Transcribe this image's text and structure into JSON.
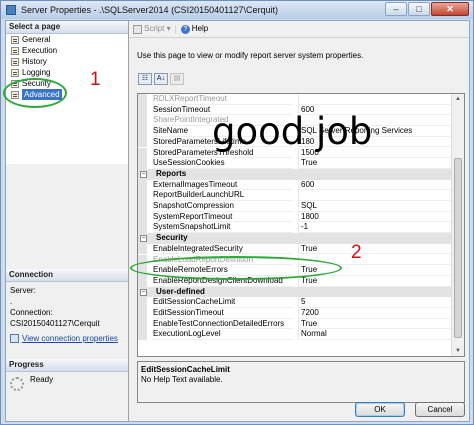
{
  "window": {
    "title": "Server Properties - .\\SQLServer2014 (CSI20150401127\\Cerquit)",
    "controls": {
      "minimize": "–",
      "maximize": "□",
      "close": "✕"
    }
  },
  "sidebar": {
    "select_page_header": "Select a page",
    "pages": [
      {
        "label": "General"
      },
      {
        "label": "Execution"
      },
      {
        "label": "History"
      },
      {
        "label": "Logging"
      },
      {
        "label": "Security"
      },
      {
        "label": "Advanced",
        "selected": true
      }
    ],
    "connection": {
      "header": "Connection",
      "server_label": "Server:",
      "server_value": ".",
      "connection_label": "Connection:",
      "connection_value": "CSI20150401127\\Cerquit",
      "view_link": "View connection properties"
    },
    "progress": {
      "header": "Progress",
      "status": "Ready"
    }
  },
  "toolbar": {
    "script_label": "Script",
    "help_label": "Help"
  },
  "main": {
    "description": "Use this page to view or modify report server system properties."
  },
  "grid": {
    "rows": [
      {
        "type": "prop",
        "name": "RDLXReportTimeout",
        "value": "",
        "disabled": true
      },
      {
        "type": "prop",
        "name": "SessionTimeout",
        "value": "600"
      },
      {
        "type": "prop",
        "name": "SharePointIntegrated",
        "value": "",
        "disabled": true
      },
      {
        "type": "prop",
        "name": "SiteName",
        "value": "SQL Server Reporting Services"
      },
      {
        "type": "prop",
        "name": "StoredParametersLifetime",
        "value": "180"
      },
      {
        "type": "prop",
        "name": "StoredParametersThreshold",
        "value": "1500"
      },
      {
        "type": "prop",
        "name": "UseSessionCookies",
        "value": "True"
      },
      {
        "type": "cat",
        "name": "Reports"
      },
      {
        "type": "prop",
        "name": "ExternalImagesTimeout",
        "value": "600"
      },
      {
        "type": "prop",
        "name": "ReportBuilderLaunchURL",
        "value": ""
      },
      {
        "type": "prop",
        "name": "SnapshotCompression",
        "value": "SQL"
      },
      {
        "type": "prop",
        "name": "SystemReportTimeout",
        "value": "1800"
      },
      {
        "type": "prop",
        "name": "SystemSnapshotLimit",
        "value": "-1"
      },
      {
        "type": "cat",
        "name": "Security"
      },
      {
        "type": "prop",
        "name": "EnableIntegratedSecurity",
        "value": "True"
      },
      {
        "type": "prop",
        "name": "EnableLoadReportDefinition",
        "value": "",
        "disabled": true
      },
      {
        "type": "prop",
        "name": "EnableRemoteErrors",
        "value": "True"
      },
      {
        "type": "prop",
        "name": "EnableReportDesignClientDownload",
        "value": "True"
      },
      {
        "type": "cat",
        "name": "User-defined"
      },
      {
        "type": "prop",
        "name": "EditSessionCacheLimit",
        "value": "5"
      },
      {
        "type": "prop",
        "name": "EditSessionTimeout",
        "value": "7200"
      },
      {
        "type": "prop",
        "name": "EnableTestConnectionDetailedErrors",
        "value": "True"
      },
      {
        "type": "prop",
        "name": "ExecutionLogLevel",
        "value": "Normal"
      }
    ]
  },
  "help_box": {
    "title": "EditSessionCacheLimit",
    "text": "No Help Text available."
  },
  "buttons": {
    "ok": "OK",
    "cancel": "Cancel"
  },
  "annotations": {
    "overlay": "good job",
    "marker1": "1",
    "marker2": "2",
    "ellipse_color": "#2fa83a",
    "marker_color": "#cc1111"
  }
}
